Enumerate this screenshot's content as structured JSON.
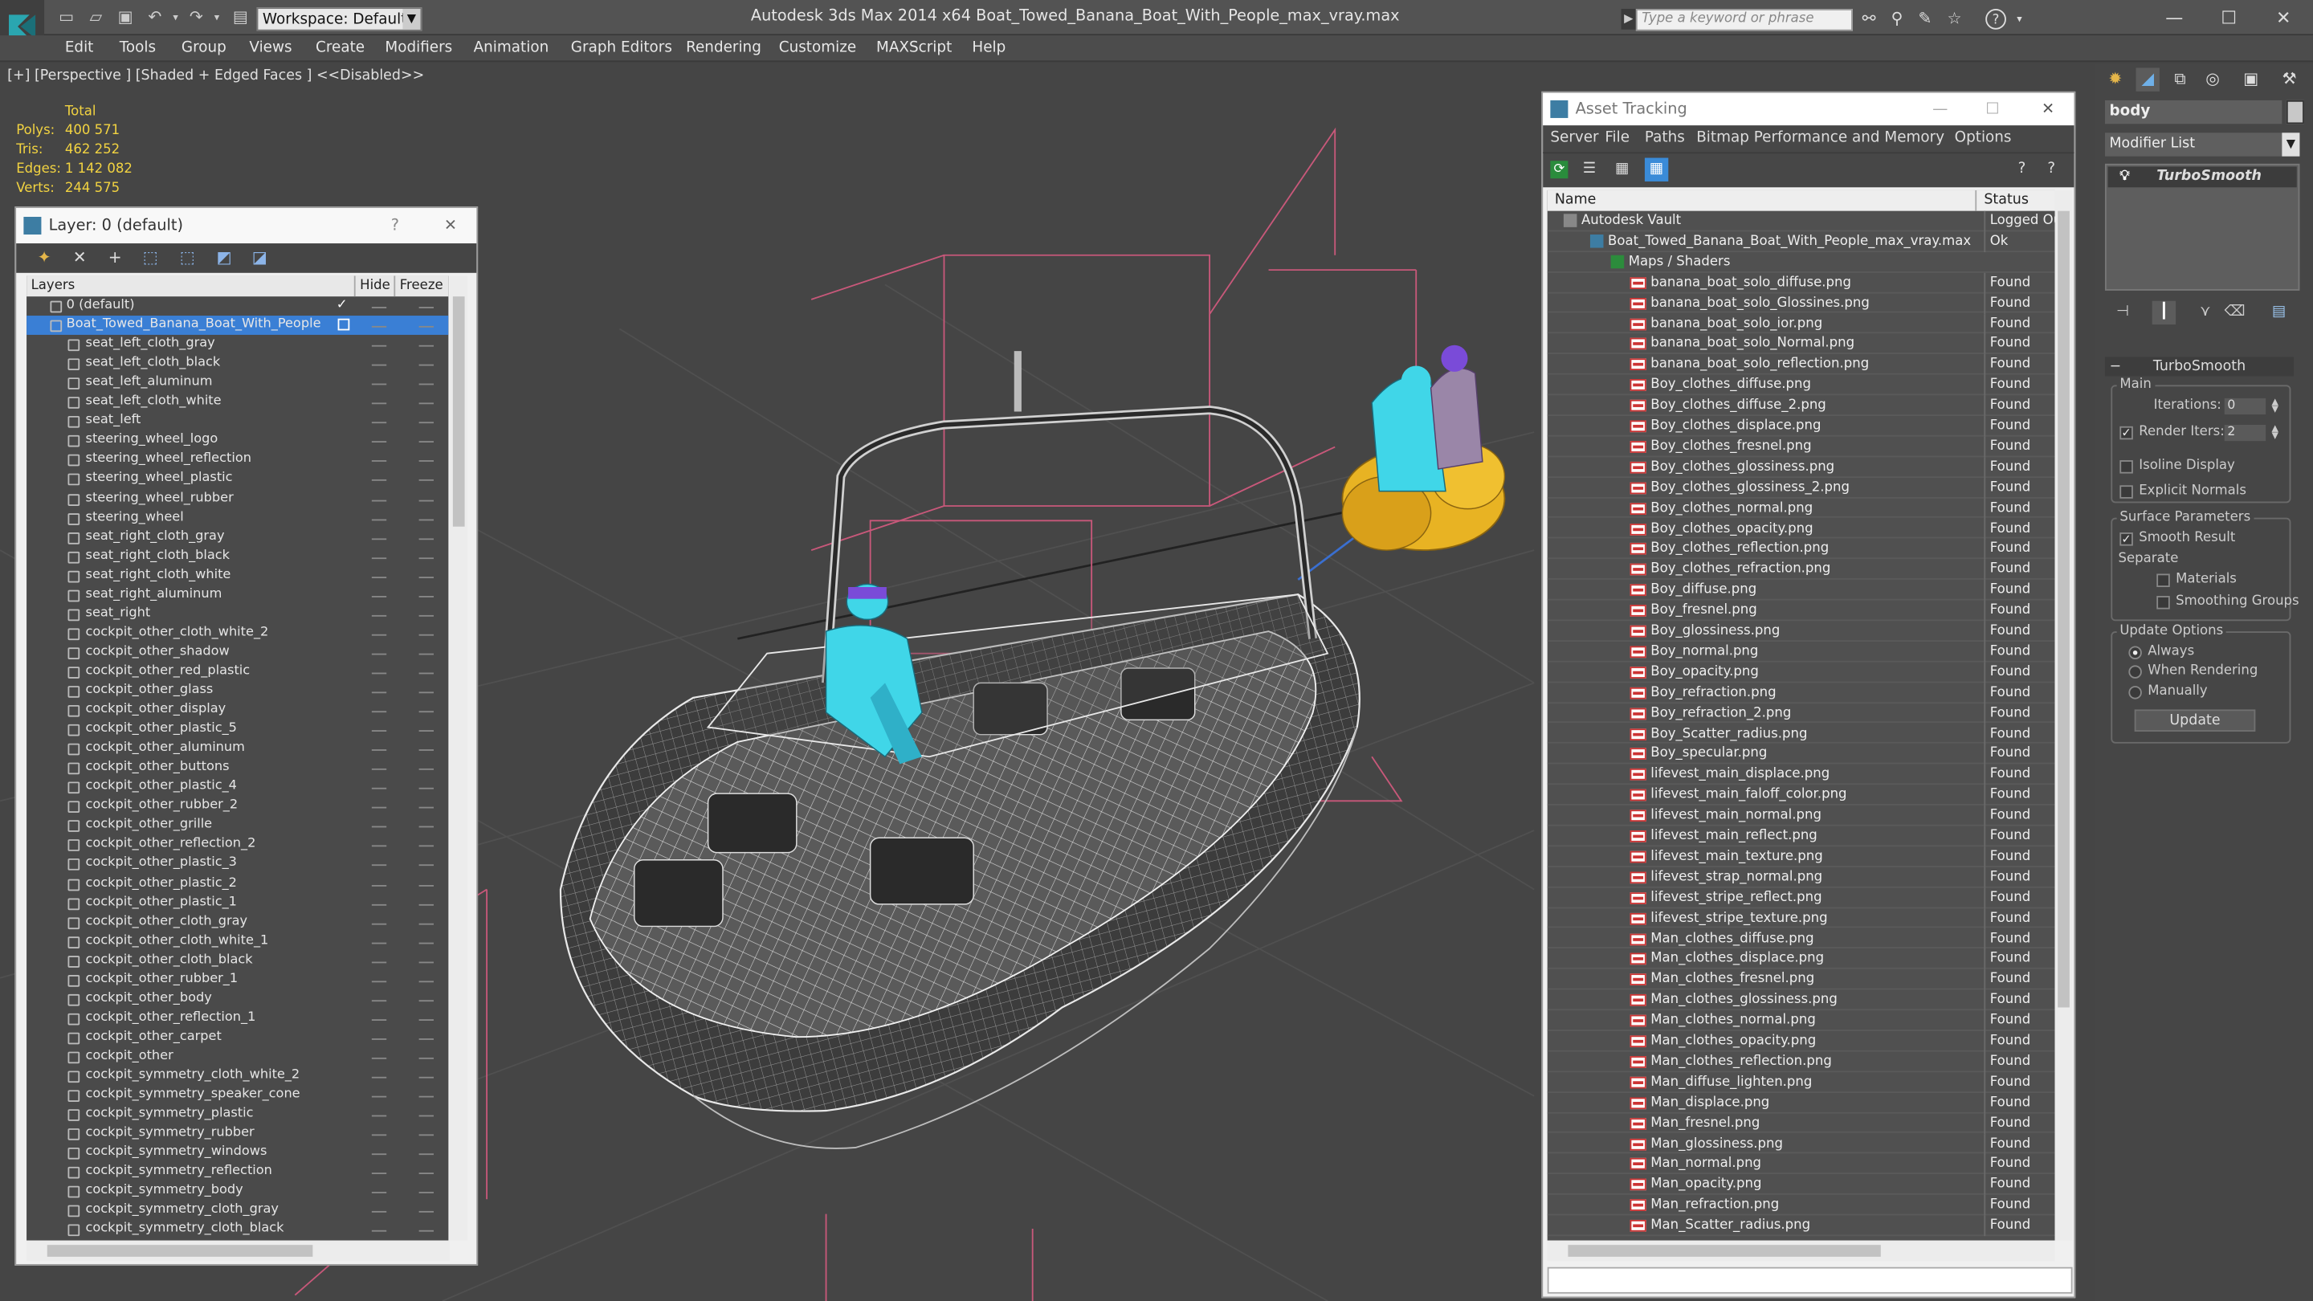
{
  "app": {
    "title": "Autodesk 3ds Max  2014 x64     Boat_Towed_Banana_Boat_With_People_max_vray.max",
    "workspace": "Workspace: Default",
    "search_placeholder": "Type a keyword or phrase"
  },
  "menu": [
    "Edit",
    "Tools",
    "Group",
    "Views",
    "Create",
    "Modifiers",
    "Animation",
    "Graph Editors",
    "Rendering",
    "Customize",
    "MAXScript",
    "Help"
  ],
  "viewport": {
    "label": "[+] [Perspective ] [Shaded + Edged Faces ]  <<Disabled>>",
    "stats": {
      "header": "Total",
      "rows": [
        {
          "label": "Polys:",
          "value": "400 571"
        },
        {
          "label": "Tris:",
          "value": "462 252"
        },
        {
          "label": "Edges:",
          "value": "1 142 082"
        },
        {
          "label": "Verts:",
          "value": "244 575"
        }
      ]
    }
  },
  "layer_window": {
    "title": "Layer: 0 (default)",
    "help": "?",
    "close": "✕",
    "columns": {
      "layers": "Layers",
      "hide": "Hide",
      "freeze": "Freeze"
    },
    "rows": [
      {
        "name": "0 (default)",
        "level": 0
      },
      {
        "name": "Boat_Towed_Banana_Boat_With_People",
        "level": 0,
        "selected": true
      },
      {
        "name": "seat_left_cloth_gray",
        "level": 1
      },
      {
        "name": "seat_left_cloth_black",
        "level": 1
      },
      {
        "name": "seat_left_aluminum",
        "level": 1
      },
      {
        "name": "seat_left_cloth_white",
        "level": 1
      },
      {
        "name": "seat_left",
        "level": 1
      },
      {
        "name": "steering_wheel_logo",
        "level": 1
      },
      {
        "name": "steering_wheel_reflection",
        "level": 1
      },
      {
        "name": "steering_wheel_plastic",
        "level": 1
      },
      {
        "name": "steering_wheel_rubber",
        "level": 1
      },
      {
        "name": "steering_wheel",
        "level": 1
      },
      {
        "name": "seat_right_cloth_gray",
        "level": 1
      },
      {
        "name": "seat_right_cloth_black",
        "level": 1
      },
      {
        "name": "seat_right_cloth_white",
        "level": 1
      },
      {
        "name": "seat_right_aluminum",
        "level": 1
      },
      {
        "name": "seat_right",
        "level": 1
      },
      {
        "name": "cockpit_other_cloth_white_2",
        "level": 1
      },
      {
        "name": "cockpit_other_shadow",
        "level": 1
      },
      {
        "name": "cockpit_other_red_plastic",
        "level": 1
      },
      {
        "name": "cockpit_other_glass",
        "level": 1
      },
      {
        "name": "cockpit_other_display",
        "level": 1
      },
      {
        "name": "cockpit_other_plastic_5",
        "level": 1
      },
      {
        "name": "cockpit_other_aluminum",
        "level": 1
      },
      {
        "name": "cockpit_other_buttons",
        "level": 1
      },
      {
        "name": "cockpit_other_plastic_4",
        "level": 1
      },
      {
        "name": "cockpit_other_rubber_2",
        "level": 1
      },
      {
        "name": "cockpit_other_grille",
        "level": 1
      },
      {
        "name": "cockpit_other_reflection_2",
        "level": 1
      },
      {
        "name": "cockpit_other_plastic_3",
        "level": 1
      },
      {
        "name": "cockpit_other_plastic_2",
        "level": 1
      },
      {
        "name": "cockpit_other_plastic_1",
        "level": 1
      },
      {
        "name": "cockpit_other_cloth_gray",
        "level": 1
      },
      {
        "name": "cockpit_other_cloth_white_1",
        "level": 1
      },
      {
        "name": "cockpit_other_cloth_black",
        "level": 1
      },
      {
        "name": "cockpit_other_rubber_1",
        "level": 1
      },
      {
        "name": "cockpit_other_body",
        "level": 1
      },
      {
        "name": "cockpit_other_reflection_1",
        "level": 1
      },
      {
        "name": "cockpit_other_carpet",
        "level": 1
      },
      {
        "name": "cockpit_other",
        "level": 1
      },
      {
        "name": "cockpit_symmetry_cloth_white_2",
        "level": 1
      },
      {
        "name": "cockpit_symmetry_speaker_cone",
        "level": 1
      },
      {
        "name": "cockpit_symmetry_plastic",
        "level": 1
      },
      {
        "name": "cockpit_symmetry_rubber",
        "level": 1
      },
      {
        "name": "cockpit_symmetry_windows",
        "level": 1
      },
      {
        "name": "cockpit_symmetry_reflection",
        "level": 1
      },
      {
        "name": "cockpit_symmetry_body",
        "level": 1
      },
      {
        "name": "cockpit_symmetry_cloth_gray",
        "level": 1
      },
      {
        "name": "cockpit_symmetry_cloth_black",
        "level": 1
      }
    ]
  },
  "asset_window": {
    "title": "Asset Tracking",
    "menu": [
      "Server",
      "File",
      "Paths",
      "Bitmap Performance and Memory",
      "Options"
    ],
    "columns": {
      "name": "Name",
      "status": "Status"
    },
    "rows": [
      {
        "name": "Autodesk Vault",
        "status": "Logged Ou",
        "level": 0,
        "kind": "vault"
      },
      {
        "name": "Boat_Towed_Banana_Boat_With_People_max_vray.max",
        "status": "Ok",
        "level": 1,
        "kind": "max"
      },
      {
        "name": "Maps / Shaders",
        "status": "",
        "level": 2,
        "kind": "folder"
      },
      {
        "name": "banana_boat_solo_diffuse.png",
        "status": "Found",
        "level": 3,
        "kind": "png"
      },
      {
        "name": "banana_boat_solo_Glossines.png",
        "status": "Found",
        "level": 3,
        "kind": "png"
      },
      {
        "name": "banana_boat_solo_ior.png",
        "status": "Found",
        "level": 3,
        "kind": "png"
      },
      {
        "name": "banana_boat_solo_Normal.png",
        "status": "Found",
        "level": 3,
        "kind": "png"
      },
      {
        "name": "banana_boat_solo_reflection.png",
        "status": "Found",
        "level": 3,
        "kind": "png"
      },
      {
        "name": "Boy_clothes_diffuse.png",
        "status": "Found",
        "level": 3,
        "kind": "png"
      },
      {
        "name": "Boy_clothes_diffuse_2.png",
        "status": "Found",
        "level": 3,
        "kind": "png"
      },
      {
        "name": "Boy_clothes_displace.png",
        "status": "Found",
        "level": 3,
        "kind": "png"
      },
      {
        "name": "Boy_clothes_fresnel.png",
        "status": "Found",
        "level": 3,
        "kind": "png"
      },
      {
        "name": "Boy_clothes_glossiness.png",
        "status": "Found",
        "level": 3,
        "kind": "png"
      },
      {
        "name": "Boy_clothes_glossiness_2.png",
        "status": "Found",
        "level": 3,
        "kind": "png"
      },
      {
        "name": "Boy_clothes_normal.png",
        "status": "Found",
        "level": 3,
        "kind": "png"
      },
      {
        "name": "Boy_clothes_opacity.png",
        "status": "Found",
        "level": 3,
        "kind": "png"
      },
      {
        "name": "Boy_clothes_reflection.png",
        "status": "Found",
        "level": 3,
        "kind": "png"
      },
      {
        "name": "Boy_clothes_refraction.png",
        "status": "Found",
        "level": 3,
        "kind": "png"
      },
      {
        "name": "Boy_diffuse.png",
        "status": "Found",
        "level": 3,
        "kind": "png"
      },
      {
        "name": "Boy_fresnel.png",
        "status": "Found",
        "level": 3,
        "kind": "png"
      },
      {
        "name": "Boy_glossiness.png",
        "status": "Found",
        "level": 3,
        "kind": "png"
      },
      {
        "name": "Boy_normal.png",
        "status": "Found",
        "level": 3,
        "kind": "png"
      },
      {
        "name": "Boy_opacity.png",
        "status": "Found",
        "level": 3,
        "kind": "png"
      },
      {
        "name": "Boy_refraction.png",
        "status": "Found",
        "level": 3,
        "kind": "png"
      },
      {
        "name": "Boy_refraction_2.png",
        "status": "Found",
        "level": 3,
        "kind": "png"
      },
      {
        "name": "Boy_Scatter_radius.png",
        "status": "Found",
        "level": 3,
        "kind": "png"
      },
      {
        "name": "Boy_specular.png",
        "status": "Found",
        "level": 3,
        "kind": "png"
      },
      {
        "name": "lifevest_main_displace.png",
        "status": "Found",
        "level": 3,
        "kind": "png"
      },
      {
        "name": "lifevest_main_faloff_color.png",
        "status": "Found",
        "level": 3,
        "kind": "png"
      },
      {
        "name": "lifevest_main_normal.png",
        "status": "Found",
        "level": 3,
        "kind": "png"
      },
      {
        "name": "lifevest_main_reflect.png",
        "status": "Found",
        "level": 3,
        "kind": "png"
      },
      {
        "name": "lifevest_main_texture.png",
        "status": "Found",
        "level": 3,
        "kind": "png"
      },
      {
        "name": "lifevest_strap_normal.png",
        "status": "Found",
        "level": 3,
        "kind": "png"
      },
      {
        "name": "lifevest_stripe_reflect.png",
        "status": "Found",
        "level": 3,
        "kind": "png"
      },
      {
        "name": "lifevest_stripe_texture.png",
        "status": "Found",
        "level": 3,
        "kind": "png"
      },
      {
        "name": "Man_clothes_diffuse.png",
        "status": "Found",
        "level": 3,
        "kind": "png"
      },
      {
        "name": "Man_clothes_displace.png",
        "status": "Found",
        "level": 3,
        "kind": "png"
      },
      {
        "name": "Man_clothes_fresnel.png",
        "status": "Found",
        "level": 3,
        "kind": "png"
      },
      {
        "name": "Man_clothes_glossiness.png",
        "status": "Found",
        "level": 3,
        "kind": "png"
      },
      {
        "name": "Man_clothes_normal.png",
        "status": "Found",
        "level": 3,
        "kind": "png"
      },
      {
        "name": "Man_clothes_opacity.png",
        "status": "Found",
        "level": 3,
        "kind": "png"
      },
      {
        "name": "Man_clothes_reflection.png",
        "status": "Found",
        "level": 3,
        "kind": "png"
      },
      {
        "name": "Man_diffuse_lighten.png",
        "status": "Found",
        "level": 3,
        "kind": "png"
      },
      {
        "name": "Man_displace.png",
        "status": "Found",
        "level": 3,
        "kind": "png"
      },
      {
        "name": "Man_fresnel.png",
        "status": "Found",
        "level": 3,
        "kind": "png"
      },
      {
        "name": "Man_glossiness.png",
        "status": "Found",
        "level": 3,
        "kind": "png"
      },
      {
        "name": "Man_normal.png",
        "status": "Found",
        "level": 3,
        "kind": "png"
      },
      {
        "name": "Man_opacity.png",
        "status": "Found",
        "level": 3,
        "kind": "png"
      },
      {
        "name": "Man_refraction.png",
        "status": "Found",
        "level": 3,
        "kind": "png"
      },
      {
        "name": "Man_Scatter_radius.png",
        "status": "Found",
        "level": 3,
        "kind": "png"
      }
    ]
  },
  "command_panel": {
    "object_name": "body",
    "modifier_list": "Modifier List",
    "stack_item": "TurboSmooth",
    "rollout_title": "TurboSmooth",
    "main_group": "Main",
    "iterations_label": "Iterations:",
    "iterations_value": "0",
    "render_iters_label": "Render Iters:",
    "render_iters_value": "2",
    "render_iters_checked": true,
    "isoline_label": "Isoline Display",
    "explicit_normals_label": "Explicit Normals",
    "surface_group": "Surface Parameters",
    "smooth_result_label": "Smooth Result",
    "smooth_result_checked": true,
    "separate_label": "Separate",
    "materials_label": "Materials",
    "smoothing_groups_label": "Smoothing Groups",
    "update_group": "Update Options",
    "always_label": "Always",
    "when_rendering_label": "When Rendering",
    "manually_label": "Manually",
    "update_button": "Update"
  },
  "colors": {
    "stats_text": "#f2d341",
    "layer_selected": "#3a7fd5",
    "wire_pink": "#d0607a",
    "character_cyan": "#40d6e8",
    "banana_yellow": "#e8b323"
  }
}
